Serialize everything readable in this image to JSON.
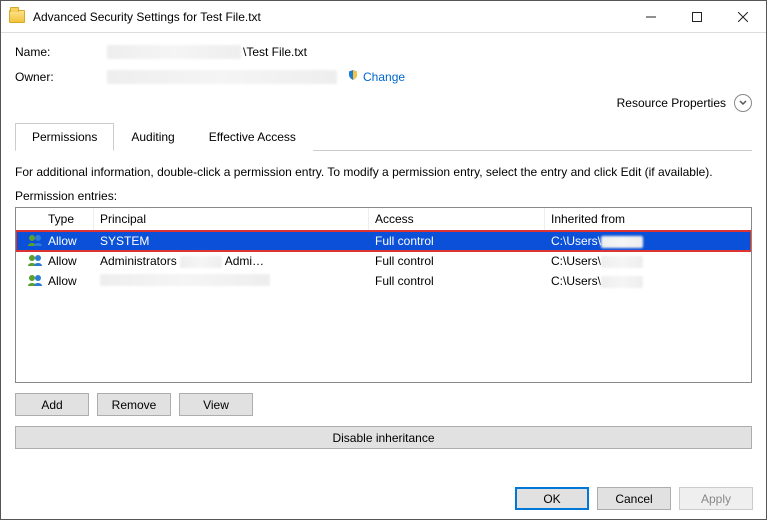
{
  "window": {
    "title": "Advanced Security Settings for Test File.txt"
  },
  "fields": {
    "name_label": "Name:",
    "name_suffix": "\\Test File.txt",
    "owner_label": "Owner:",
    "change_link": "Change",
    "resource_properties": "Resource Properties"
  },
  "tabs": {
    "permissions": "Permissions",
    "auditing": "Auditing",
    "effective": "Effective Access"
  },
  "info_text": "For additional information, double-click a permission entry. To modify a permission entry, select the entry and click Edit (if available).",
  "perm_entries_label": "Permission entries:",
  "columns": {
    "type": "Type",
    "principal": "Principal",
    "access": "Access",
    "inherited": "Inherited from"
  },
  "rows": [
    {
      "type": "Allow",
      "principal": "SYSTEM",
      "principal_suffix": "",
      "access": "Full control",
      "inherited": "C:\\Users\\",
      "selected": true
    },
    {
      "type": "Allow",
      "principal": "Administrators",
      "principal_suffix": "Admi…",
      "access": "Full control",
      "inherited": "C:\\Users\\",
      "selected": false
    },
    {
      "type": "Allow",
      "principal": "",
      "principal_suffix": "",
      "access": "Full control",
      "inherited": "C:\\Users\\",
      "selected": false
    }
  ],
  "buttons": {
    "add": "Add",
    "remove": "Remove",
    "view": "View",
    "disable_inherit": "Disable inheritance",
    "ok": "OK",
    "cancel": "Cancel",
    "apply": "Apply"
  }
}
